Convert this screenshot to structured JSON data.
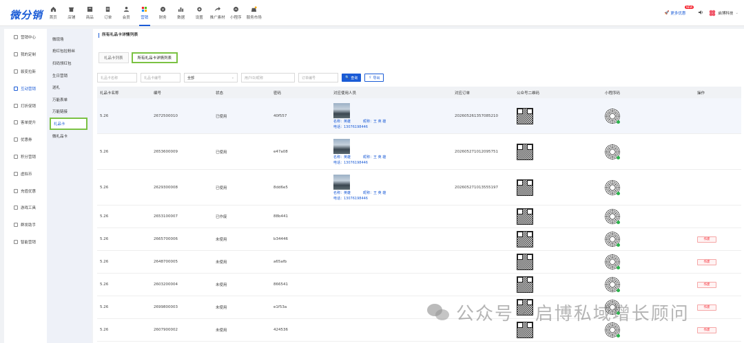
{
  "app": {
    "logo": "微分销"
  },
  "nav": [
    {
      "label": "首页",
      "icon": "home-icon"
    },
    {
      "label": "店铺",
      "icon": "shop-icon"
    },
    {
      "label": "商品",
      "icon": "goods-icon"
    },
    {
      "label": "订单",
      "icon": "order-icon"
    },
    {
      "label": "会员",
      "icon": "member-icon"
    },
    {
      "label": "营销",
      "icon": "marketing-icon",
      "active": true
    },
    {
      "label": "财务",
      "icon": "finance-icon"
    },
    {
      "label": "数据",
      "icon": "data-icon"
    },
    {
      "label": "设置",
      "icon": "settings-icon"
    },
    {
      "label": "推广素材",
      "icon": "share-icon"
    },
    {
      "label": "小程序",
      "icon": "miniprogram-icon"
    },
    {
      "label": "服务市场",
      "icon": "market-icon"
    }
  ],
  "topright": {
    "more_label": "更多优惠",
    "badge": "NEW",
    "company": "启博科技"
  },
  "sidebar": [
    {
      "label": "营销中心"
    },
    {
      "label": "我的定制"
    },
    {
      "label": "裂变拉新"
    },
    {
      "label": "互动营销",
      "active": true
    },
    {
      "label": "打折促销"
    },
    {
      "label": "客单提升"
    },
    {
      "label": "优惠券"
    },
    {
      "label": "积分营销"
    },
    {
      "label": "虚拟币"
    },
    {
      "label": "充值优惠"
    },
    {
      "label": "游戏工具"
    },
    {
      "label": "群发助手"
    },
    {
      "label": "智能营销"
    }
  ],
  "submenu": [
    {
      "label": "微现场"
    },
    {
      "label": "抢红包拉粉丝"
    },
    {
      "label": "扫码领红包"
    },
    {
      "label": "生日营销"
    },
    {
      "label": "送礼"
    },
    {
      "label": "万能表单"
    },
    {
      "label": "万能链接"
    },
    {
      "label": "礼品卡",
      "active": true
    },
    {
      "label": "微礼品卡"
    }
  ],
  "page": {
    "title": "所有礼品卡详情列表",
    "tabs": [
      {
        "label": "礼品卡列表"
      },
      {
        "label": "所有礼品卡详情列表",
        "active": true
      }
    ]
  },
  "filters": {
    "name_ph": "礼品卡名称",
    "code_ph": "礼品卡编号",
    "status_val": "全部",
    "user_ph": "用户ID/昵称",
    "order_ph": "订单编号",
    "search_label": "查询",
    "export_label": "导出"
  },
  "table": {
    "headers": [
      "礼品卡名称",
      "编号",
      "状态",
      "密码",
      "对应使用人员",
      "对应订单",
      "公众号二维码",
      "小程序码",
      "操作"
    ],
    "rows": [
      {
        "name": "5.26",
        "code": "2672500010",
        "status": "已使用",
        "pwd": "40f557",
        "person": {
          "name": "名称：英雄",
          "nick": "昵称：王 英 雄",
          "tel": "电话：13076198446"
        },
        "order": "202605261357085210",
        "op": ""
      },
      {
        "name": "5.26",
        "code": "2653600009",
        "status": "已使用",
        "pwd": "e47a08",
        "person": {
          "name": "名称：英雄",
          "nick": "昵称：王 英 雄",
          "tel": "电话：13076198446"
        },
        "order": "202605271012095751",
        "op": ""
      },
      {
        "name": "5.26",
        "code": "2629300008",
        "status": "已使用",
        "pwd": "8dd6e5",
        "person": {
          "name": "名称：英雄",
          "nick": "昵称：王 英 雄",
          "tel": "电话：13076198446"
        },
        "order": "202605271013555197",
        "op": ""
      },
      {
        "name": "5.26",
        "code": "2653100007",
        "status": "已作废",
        "pwd": "88b441",
        "person": null,
        "order": "",
        "op": ""
      },
      {
        "name": "5.26",
        "code": "2665700006",
        "status": "未使用",
        "pwd": "b34446",
        "person": null,
        "order": "",
        "op": "作废"
      },
      {
        "name": "5.26",
        "code": "2648700005",
        "status": "未使用",
        "pwd": "a65afb",
        "person": null,
        "order": "",
        "op": "作废"
      },
      {
        "name": "5.26",
        "code": "2603200004",
        "status": "未使用",
        "pwd": "866541",
        "person": null,
        "order": "",
        "op": "作废"
      },
      {
        "name": "5.26",
        "code": "2699800003",
        "status": "未使用",
        "pwd": "e1f53a",
        "person": null,
        "order": "",
        "op": "作废"
      },
      {
        "name": "5.26",
        "code": "2607900002",
        "status": "未使用",
        "pwd": "424536",
        "person": null,
        "order": "",
        "op": "作废"
      }
    ]
  },
  "watermark": "公众号 · 启博私域增长顾问"
}
